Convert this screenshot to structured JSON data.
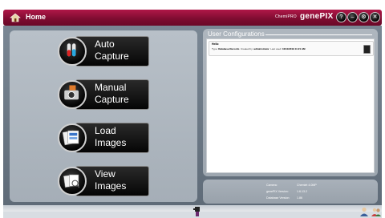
{
  "titlebar": {
    "home_label": "Home",
    "brand_small": "ChemiPRO",
    "brand_main": "genePIX",
    "buttons": [
      "help",
      "minimize",
      "settings",
      "close"
    ]
  },
  "menu": [
    {
      "line1": "Auto",
      "line2": "Capture",
      "icon": "test-tubes-icon"
    },
    {
      "line1": "Manual",
      "line2": "Capture",
      "icon": "camera-icon"
    },
    {
      "line1": "Load",
      "line2": "Images",
      "icon": "images-stack-icon"
    },
    {
      "line1": "View",
      "line2": "Images",
      "icon": "view-images-icon"
    }
  ],
  "user_config": {
    "title": "User Configurations",
    "items": [
      {
        "name": "Hello",
        "type_label": "Type:",
        "type_value": "Database Records",
        "created_label": "Created by:",
        "created_value": "administrator",
        "last_used_label": "Last used:",
        "last_used_value": "10/11/2019 11:21 AM"
      }
    ]
  },
  "versions": {
    "rows": [
      {
        "label": "Camera:",
        "value": "Chemiet 4.0MP"
      },
      {
        "label": "genePIX Version:",
        "value": "1.6.13.2"
      },
      {
        "label": "Database Version:",
        "value": "1.86"
      }
    ]
  },
  "colors": {
    "title_bar": "#8a0f38",
    "panel": "#b0b8c0",
    "accent_dark": "#000000"
  }
}
